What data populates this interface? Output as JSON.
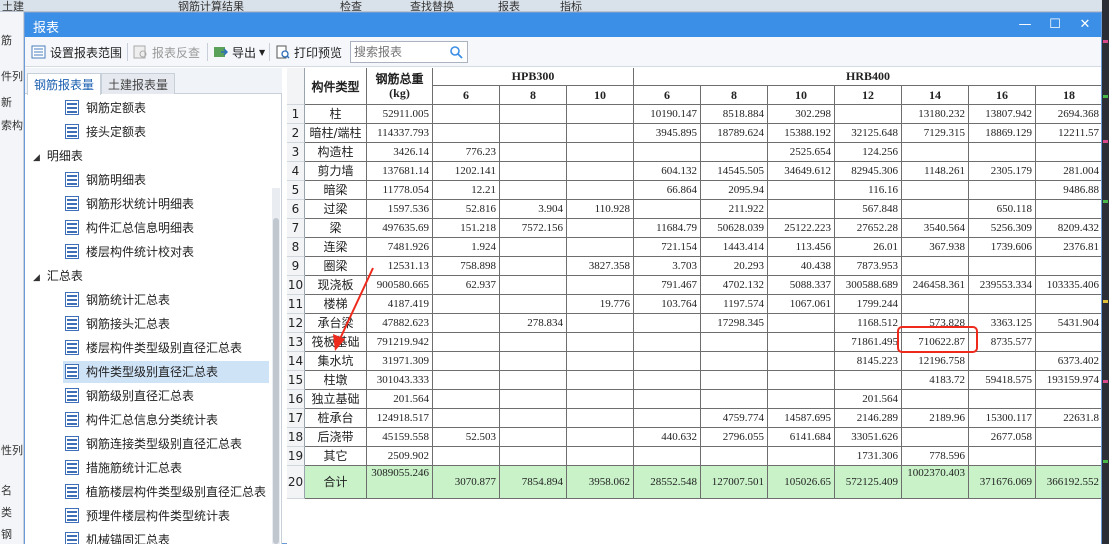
{
  "background": {
    "topbar_items": [
      "土建",
      "钢筋计算结果",
      "检查",
      "查找替换",
      "报表",
      "指标"
    ],
    "left_strip_items": [
      "筋",
      "件列",
      "新",
      "索构",
      "性列",
      "名",
      "类",
      "钢"
    ]
  },
  "dialog": {
    "title": "报表",
    "controls": {
      "minimize": "—",
      "maximize": "☐",
      "close": "✕"
    }
  },
  "toolbar": {
    "set_range": "设置报表范围",
    "query": "报表反查",
    "export": "导出",
    "print_preview": "打印预览",
    "search_placeholder": "搜索报表"
  },
  "left_tabs": {
    "rebar": "钢筋报表量",
    "civil": "土建报表量"
  },
  "tree": {
    "top_items": [
      "钢筋定额表",
      "接头定额表"
    ],
    "group_detail": "明细表",
    "detail_items": [
      "钢筋明细表",
      "钢筋形状统计明细表",
      "构件汇总信息明细表",
      "楼层构件统计校对表"
    ],
    "group_summary": "汇总表",
    "summary_items": [
      "钢筋统计汇总表",
      "钢筋接头汇总表",
      "楼层构件类型级别直径汇总表",
      "构件类型级别直径汇总表",
      "钢筋级别直径汇总表",
      "构件汇总信息分类统计表",
      "钢筋连接类型级别直径汇总表",
      "措施筋统计汇总表",
      "植筋楼层构件类型级别直径汇总表",
      "预埋件楼层构件类型统计表",
      "机械锚固汇总表"
    ],
    "selected": "构件类型级别直径汇总表"
  },
  "table": {
    "header": {
      "type_col": "构件类型",
      "total_col": "钢筋总重(kg)",
      "grade1": "HPB300",
      "grade2": "HRB400",
      "diameters": [
        "6",
        "8",
        "10",
        "6",
        "8",
        "10",
        "12",
        "14",
        "16",
        "18"
      ]
    },
    "rows": [
      {
        "n": "1",
        "name": "柱",
        "total": "52911.005",
        "v": [
          "",
          "",
          "",
          "10190.147",
          "8518.884",
          "302.298",
          "",
          "13180.232",
          "13807.942",
          "2694.368"
        ]
      },
      {
        "n": "2",
        "name": "暗柱/端柱",
        "total": "114337.793",
        "v": [
          "",
          "",
          "",
          "3945.895",
          "18789.624",
          "15388.192",
          "32125.648",
          "7129.315",
          "18869.129",
          "12211.57"
        ]
      },
      {
        "n": "3",
        "name": "构造柱",
        "total": "3426.14",
        "v": [
          "776.23",
          "",
          "",
          "",
          "",
          "2525.654",
          "124.256",
          "",
          "",
          ""
        ]
      },
      {
        "n": "4",
        "name": "剪力墙",
        "total": "137681.14",
        "v": [
          "1202.141",
          "",
          "",
          "604.132",
          "14545.505",
          "34649.612",
          "82945.306",
          "1148.261",
          "2305.179",
          "281.004"
        ]
      },
      {
        "n": "5",
        "name": "暗梁",
        "total": "11778.054",
        "v": [
          "12.21",
          "",
          "",
          "66.864",
          "2095.94",
          "",
          "116.16",
          "",
          "",
          "9486.88"
        ]
      },
      {
        "n": "6",
        "name": "过梁",
        "total": "1597.536",
        "v": [
          "52.816",
          "3.904",
          "110.928",
          "",
          "211.922",
          "",
          "567.848",
          "",
          "650.118",
          ""
        ]
      },
      {
        "n": "7",
        "name": "梁",
        "total": "497635.69",
        "v": [
          "151.218",
          "7572.156",
          "",
          "11684.79",
          "50628.039",
          "25122.223",
          "27652.28",
          "3540.564",
          "5256.309",
          "8209.432"
        ]
      },
      {
        "n": "8",
        "name": "连梁",
        "total": "7481.926",
        "v": [
          "1.924",
          "",
          "",
          "721.154",
          "1443.414",
          "113.456",
          "26.01",
          "367.938",
          "1739.606",
          "2376.81"
        ]
      },
      {
        "n": "9",
        "name": "圈梁",
        "total": "12531.13",
        "v": [
          "758.898",
          "",
          "3827.358",
          "3.703",
          "20.293",
          "40.438",
          "7873.953",
          "",
          "",
          ""
        ]
      },
      {
        "n": "10",
        "name": "现浇板",
        "total": "900580.665",
        "v": [
          "62.937",
          "",
          "",
          "791.467",
          "4702.132",
          "5088.337",
          "300588.689",
          "246458.361",
          "239553.334",
          "103335.406"
        ]
      },
      {
        "n": "11",
        "name": "楼梯",
        "total": "4187.419",
        "v": [
          "",
          "",
          "19.776",
          "103.764",
          "1197.574",
          "1067.061",
          "1799.244",
          "",
          "",
          ""
        ]
      },
      {
        "n": "12",
        "name": "承台梁",
        "total": "47882.623",
        "v": [
          "",
          "278.834",
          "",
          "",
          "17298.345",
          "",
          "1168.512",
          "573.828",
          "3363.125",
          "5431.904"
        ]
      },
      {
        "n": "13",
        "name": "筏板基础",
        "total": "791219.942",
        "v": [
          "",
          "",
          "",
          "",
          "",
          "",
          "71861.495",
          "710622.87",
          "8735.577",
          ""
        ]
      },
      {
        "n": "14",
        "name": "集水坑",
        "total": "31971.309",
        "v": [
          "",
          "",
          "",
          "",
          "",
          "",
          "8145.223",
          "12196.758",
          "",
          "6373.402"
        ]
      },
      {
        "n": "15",
        "name": "柱墩",
        "total": "301043.333",
        "v": [
          "",
          "",
          "",
          "",
          "",
          "",
          "",
          "4183.72",
          "59418.575",
          "193159.974"
        ]
      },
      {
        "n": "16",
        "name": "独立基础",
        "total": "201.564",
        "v": [
          "",
          "",
          "",
          "",
          "",
          "",
          "201.564",
          "",
          "",
          ""
        ]
      },
      {
        "n": "17",
        "name": "桩承台",
        "total": "124918.517",
        "v": [
          "",
          "",
          "",
          "",
          "4759.774",
          "14587.695",
          "2146.289",
          "2189.96",
          "15300.117",
          "22631.8"
        ]
      },
      {
        "n": "18",
        "name": "后浇带",
        "total": "45159.558",
        "v": [
          "52.503",
          "",
          "",
          "440.632",
          "2796.055",
          "6141.684",
          "33051.626",
          "",
          "2677.058",
          ""
        ]
      },
      {
        "n": "19",
        "name": "其它",
        "total": "2509.902",
        "v": [
          "",
          "",
          "",
          "",
          "",
          "",
          "1731.306",
          "778.596",
          "",
          ""
        ]
      },
      {
        "n": "20",
        "name": "合计",
        "total": "3089055.246",
        "v": [
          "3070.877",
          "7854.894",
          "3958.062",
          "28552.548",
          "127007.501",
          "105026.65",
          "572125.409",
          "1002370.403",
          "371676.069",
          "366192.552"
        ]
      }
    ]
  },
  "colors": {
    "titlebar": "#3c8fe6",
    "highlight_box": "#ee2a1c",
    "total_row": "#c9f2c9",
    "selected_node": "#cfe3f7"
  }
}
